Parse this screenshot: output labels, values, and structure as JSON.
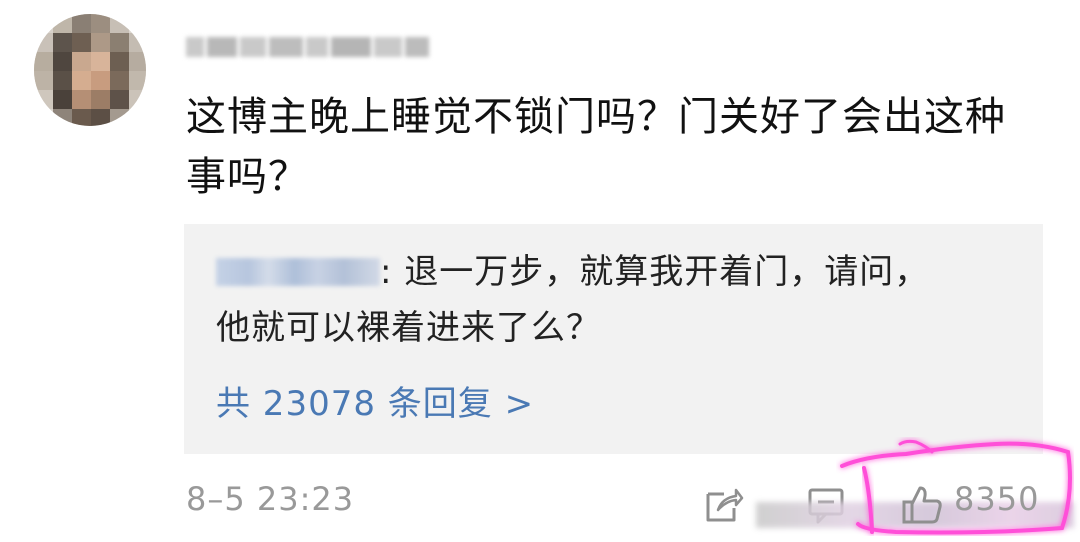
{
  "comment": {
    "text": "这博主晚上睡觉不锁门吗？门关好了会出这种事吗？"
  },
  "reply": {
    "separator": ":",
    "text": " 退一万步，就算我开着门，请问，他就可以裸着进来了么？",
    "link_color": "#4a79b4"
  },
  "replies_link": {
    "label": "共 23078 条回复 >"
  },
  "meta": {
    "timestamp": "8–5 23:23"
  },
  "actions": {
    "share_icon": "share-icon",
    "comment_icon": "comment-icon",
    "like_icon": "thumbs-up-icon",
    "like_count": "8350"
  },
  "colors": {
    "highlight": "#ff4fd8",
    "reply_bg": "#f2f2f2"
  }
}
